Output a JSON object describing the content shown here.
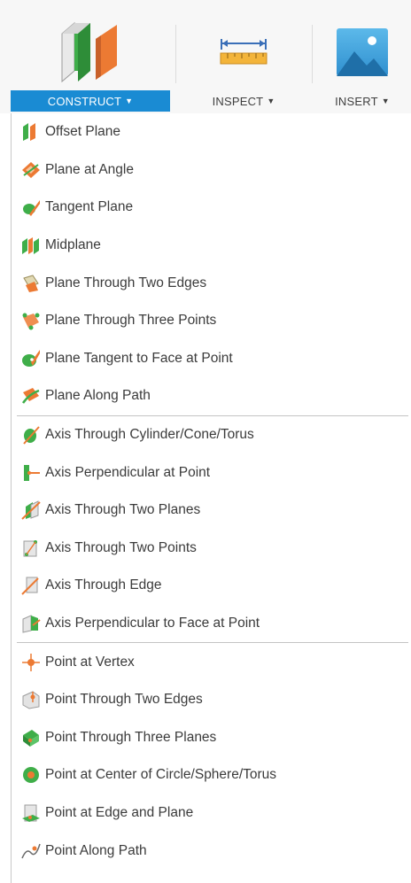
{
  "toolbar": {
    "groups": [
      {
        "label": "CONSTRUCT",
        "icon": "construct-planes-icon",
        "active": true
      },
      {
        "label": "INSPECT",
        "icon": "measure-ruler-icon",
        "active": false
      },
      {
        "label": "INSERT",
        "icon": "insert-image-icon",
        "active": false
      }
    ],
    "active_color": "#1a8bd3"
  },
  "menu": {
    "sections": [
      {
        "items": [
          {
            "label": "Offset Plane",
            "icon": "offset-plane-icon"
          },
          {
            "label": "Plane at Angle",
            "icon": "plane-at-angle-icon"
          },
          {
            "label": "Tangent Plane",
            "icon": "tangent-plane-icon"
          },
          {
            "label": "Midplane",
            "icon": "midplane-icon"
          },
          {
            "label": "Plane Through Two Edges",
            "icon": "plane-two-edges-icon"
          },
          {
            "label": "Plane Through Three Points",
            "icon": "plane-three-points-icon"
          },
          {
            "label": "Plane Tangent to Face at Point",
            "icon": "plane-tangent-face-icon"
          },
          {
            "label": "Plane Along Path",
            "icon": "plane-along-path-icon"
          }
        ]
      },
      {
        "items": [
          {
            "label": "Axis Through Cylinder/Cone/Torus",
            "icon": "axis-cylinder-icon"
          },
          {
            "label": "Axis Perpendicular at Point",
            "icon": "axis-perpendicular-point-icon"
          },
          {
            "label": "Axis Through Two Planes",
            "icon": "axis-two-planes-icon"
          },
          {
            "label": "Axis Through Two Points",
            "icon": "axis-two-points-icon"
          },
          {
            "label": "Axis Through Edge",
            "icon": "axis-edge-icon"
          },
          {
            "label": "Axis Perpendicular to Face at Point",
            "icon": "axis-perpendicular-face-icon"
          }
        ]
      },
      {
        "items": [
          {
            "label": "Point at Vertex",
            "icon": "point-vertex-icon"
          },
          {
            "label": "Point Through Two Edges",
            "icon": "point-two-edges-icon"
          },
          {
            "label": "Point Through Three Planes",
            "icon": "point-three-planes-icon"
          },
          {
            "label": "Point at Center of Circle/Sphere/Torus",
            "icon": "point-center-icon"
          },
          {
            "label": "Point at Edge and Plane",
            "icon": "point-edge-plane-icon"
          },
          {
            "label": "Point Along Path",
            "icon": "point-along-path-icon"
          }
        ]
      }
    ]
  }
}
